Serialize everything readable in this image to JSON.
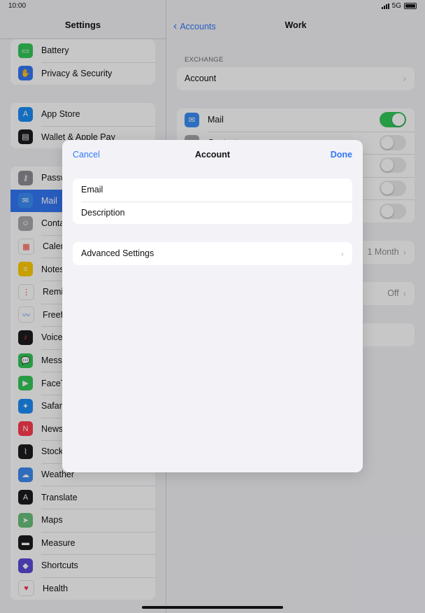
{
  "status_bar": {
    "time": "10:00",
    "network": "5G"
  },
  "sidebar": {
    "title": "Settings",
    "group1": [
      {
        "label": "Battery",
        "icon": "battery-icon",
        "color": "#34c759",
        "glyph": "▭"
      },
      {
        "label": "Privacy & Security",
        "icon": "hand-icon",
        "color": "#3478f6",
        "glyph": "✋"
      }
    ],
    "group2": [
      {
        "label": "App Store",
        "icon": "app-store-icon",
        "color": "#1c8cf5",
        "glyph": "A"
      },
      {
        "label": "Wallet & Apple Pay",
        "icon": "wallet-icon",
        "color": "#1c1c1e",
        "glyph": "▤"
      }
    ],
    "group3": [
      {
        "label": "Passw",
        "icon": "key-icon",
        "color": "#8e8e93",
        "glyph": "⚷"
      },
      {
        "label": "Mail",
        "icon": "mail-icon",
        "color": "#3b8ef5",
        "glyph": "✉",
        "selected": true
      },
      {
        "label": "Conta",
        "icon": "contacts-icon",
        "color": "#a8a8ad",
        "glyph": "☺"
      },
      {
        "label": "Calen",
        "icon": "calendar-icon",
        "color": "#ffffff",
        "glyph": "▦",
        "fg": "#ff3b30"
      },
      {
        "label": "Notes",
        "icon": "notes-icon",
        "color": "#ffcc00",
        "glyph": "≡"
      },
      {
        "label": "Remin",
        "icon": "reminders-icon",
        "color": "#ffffff",
        "glyph": "⋮",
        "fg": "#ff3b30"
      },
      {
        "label": "Freefo",
        "icon": "freeform-icon",
        "color": "#ffffff",
        "glyph": "〰",
        "fg": "#3478f6"
      },
      {
        "label": "Voice",
        "icon": "voice-memos-icon",
        "color": "#1c1c1e",
        "glyph": "♪",
        "fg": "#ff3b30"
      },
      {
        "label": "Messa",
        "icon": "messages-icon",
        "color": "#34c759",
        "glyph": "💬"
      },
      {
        "label": "FaceT",
        "icon": "facetime-icon",
        "color": "#34c759",
        "glyph": "▶"
      },
      {
        "label": "Safari",
        "icon": "safari-icon",
        "color": "#1c8cf5",
        "glyph": "✦"
      },
      {
        "label": "News",
        "icon": "news-icon",
        "color": "#ff3b4e",
        "glyph": "N"
      },
      {
        "label": "Stocks",
        "icon": "stocks-icon",
        "color": "#1c1c1e",
        "glyph": "⌇"
      },
      {
        "label": "Weather",
        "icon": "weather-icon",
        "color": "#3d8bf0",
        "glyph": "☁"
      },
      {
        "label": "Translate",
        "icon": "translate-icon",
        "color": "#1c1c1e",
        "glyph": "A"
      },
      {
        "label": "Maps",
        "icon": "maps-icon",
        "color": "#6ac07a",
        "glyph": "➤"
      },
      {
        "label": "Measure",
        "icon": "measure-icon",
        "color": "#1c1c1e",
        "glyph": "▬"
      },
      {
        "label": "Shortcuts",
        "icon": "shortcuts-icon",
        "color": "#5b4bd8",
        "glyph": "◆"
      },
      {
        "label": "Health",
        "icon": "health-icon",
        "color": "#ffffff",
        "glyph": "♥",
        "fg": "#ff2d55"
      }
    ]
  },
  "detail": {
    "back_label": "Accounts",
    "title": "Work",
    "section_header": "EXCHANGE",
    "account_row": "Account",
    "toggle_rows": [
      {
        "label": "Mail",
        "on": true
      },
      {
        "label": "Contacts",
        "on": false
      },
      {
        "label": "",
        "on": false
      },
      {
        "label": "",
        "on": false
      },
      {
        "label": "",
        "on": false
      }
    ],
    "mail_days_value": "1 Month",
    "auto_reply_value": "Off"
  },
  "modal": {
    "cancel_label": "Cancel",
    "title": "Account",
    "done_label": "Done",
    "email_label": "Email",
    "description_label": "Description",
    "advanced_label": "Advanced Settings"
  },
  "colors": {
    "accent": "#3478f6",
    "switch_on": "#34c759"
  }
}
